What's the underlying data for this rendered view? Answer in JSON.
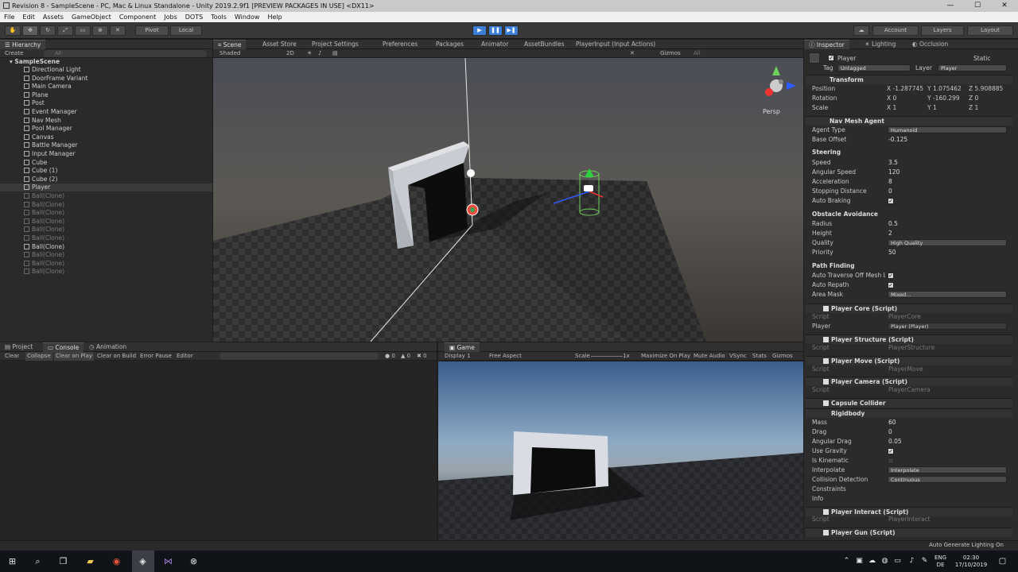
{
  "window": {
    "title": "Revision 8 - SampleScene - PC, Mac & Linux Standalone - Unity 2019.2.9f1 [PREVIEW PACKAGES IN USE] <DX11>",
    "controls": [
      "—",
      "☐",
      "✕"
    ]
  },
  "menu": [
    "File",
    "Edit",
    "Assets",
    "GameObject",
    "Component",
    "Jobs",
    "DOTS",
    "Tools",
    "Window",
    "Help"
  ],
  "toolbar": {
    "pivot": "Pivot",
    "local": "Local",
    "account": "Account",
    "layers": "Layers",
    "layout": "Layout"
  },
  "hierarchy": {
    "tab": "Hierarchy",
    "create": "Create",
    "search_placeholder": "All",
    "scene": "SampleScene",
    "items": [
      {
        "label": "Directional Light",
        "dim": false
      },
      {
        "label": "DoorFrame Variant",
        "dim": false
      },
      {
        "label": "Main Camera",
        "dim": false
      },
      {
        "label": "Plane",
        "dim": false
      },
      {
        "label": "Post",
        "dim": false
      },
      {
        "label": "Event Manager",
        "dim": false
      },
      {
        "label": "Nav Mesh",
        "dim": false
      },
      {
        "label": "Pool Manager",
        "dim": false
      },
      {
        "label": "Canvas",
        "dim": false
      },
      {
        "label": "Battle Manager",
        "dim": false
      },
      {
        "label": "Input Manager",
        "dim": false
      },
      {
        "label": "Cube",
        "dim": false
      },
      {
        "label": "Cube (1)",
        "dim": false
      },
      {
        "label": "Cube (2)",
        "dim": false
      },
      {
        "label": "Player",
        "dim": false
      },
      {
        "label": "Ball(Clone)",
        "dim": true
      },
      {
        "label": "Ball(Clone)",
        "dim": true
      },
      {
        "label": "Ball(Clone)",
        "dim": true
      },
      {
        "label": "Ball(Clone)",
        "dim": true
      },
      {
        "label": "Ball(Clone)",
        "dim": true
      },
      {
        "label": "Ball(Clone)",
        "dim": true
      },
      {
        "label": "Ball(Clone)",
        "dim": false
      },
      {
        "label": "Ball(Clone)",
        "dim": true
      },
      {
        "label": "Ball(Clone)",
        "dim": true
      },
      {
        "label": "Ball(Clone)",
        "dim": true
      }
    ]
  },
  "scene_tabs": [
    "Scene",
    "Asset Store",
    "Project Settings",
    "Preferences",
    "Packages",
    "Animator",
    "AssetBundles",
    "PlayerInput (Input Actions)"
  ],
  "scene_bar": {
    "shading": "Shaded",
    "mode_2d": "2D",
    "gizmos": "Gizmos",
    "search_placeholder": "All",
    "persp": "Persp"
  },
  "bottom_tabs": [
    "Project",
    "Console",
    "Animation"
  ],
  "console_bar": [
    "Clear",
    "Collapse",
    "Clear on Play",
    "Clear on Build",
    "Error Pause",
    "Editor"
  ],
  "console_counts": [
    "0",
    "0",
    "0"
  ],
  "game": {
    "tab": "Game",
    "display": "Display 1",
    "aspect": "Free Aspect",
    "scale_label": "Scale",
    "scale_value": "1x",
    "options": [
      "Maximize On Play",
      "Mute Audio",
      "VSync",
      "Stats",
      "Gizmos"
    ]
  },
  "inspector": {
    "tabs": [
      "Inspector",
      "Lighting",
      "Occlusion"
    ],
    "object_name": "Player",
    "static_label": "Static",
    "tag_label": "Tag",
    "tag_value": "Untagged",
    "layer_label": "Layer",
    "layer_value": "Player",
    "transform": {
      "title": "Transform",
      "position_label": "Position",
      "position": {
        "x": "-1.287745",
        "y": "1.075462",
        "z": "5.908885"
      },
      "rotation_label": "Rotation",
      "rotation": {
        "x": "0",
        "y": "-160.299",
        "z": "0"
      },
      "scale_label": "Scale",
      "scale": {
        "x": "1",
        "y": "1",
        "z": "1"
      }
    },
    "nav_agent": {
      "title": "Nav Mesh Agent",
      "agent_type_label": "Agent Type",
      "agent_type": "Humanoid",
      "base_offset_label": "Base Offset",
      "base_offset": "-0.125",
      "steering": "Steering",
      "speed_label": "Speed",
      "speed": "3.5",
      "angular_speed_label": "Angular Speed",
      "angular_speed": "120",
      "acceleration_label": "Acceleration",
      "acceleration": "8",
      "stopping_label": "Stopping Distance",
      "stopping": "0",
      "auto_braking_label": "Auto Braking",
      "obstacle": "Obstacle Avoidance",
      "radius_label": "Radius",
      "radius": "0.5",
      "height_label": "Height",
      "height": "2",
      "quality_label": "Quality",
      "quality": "High Quality",
      "priority_label": "Priority",
      "priority": "50",
      "path": "Path Finding",
      "auto_traverse_label": "Auto Traverse Off Mesh Link",
      "auto_repath_label": "Auto Repath",
      "area_mask_label": "Area Mask",
      "area_mask": "Mixed..."
    },
    "script_label": "Script",
    "player_core": {
      "title": "Player Core (Script)",
      "script": "PlayerCore",
      "player_label": "Player",
      "player": "Player (Player)"
    },
    "player_structure": {
      "title": "Player Structure (Script)",
      "script": "PlayerStructure"
    },
    "player_move": {
      "title": "Player Move (Script)",
      "script": "PlayerMove"
    },
    "player_camera": {
      "title": "Player Camera (Script)",
      "script": "PlayerCamera"
    },
    "capsule": {
      "title": "Capsule Collider"
    },
    "rigidbody": {
      "title": "Rigidbody",
      "mass_label": "Mass",
      "mass": "60",
      "drag_label": "Drag",
      "drag": "0",
      "angular_drag_label": "Angular Drag",
      "angular_drag": "0.05",
      "gravity_label": "Use Gravity",
      "kinematic_label": "Is Kinematic",
      "interpolate_label": "Interpolate",
      "interpolate": "Interpolate",
      "collision_label": "Collision Detection",
      "collision": "Continuous",
      "constraints_label": "Constraints",
      "info_label": "Info"
    },
    "player_interact": {
      "title": "Player Interact (Script)",
      "script": "PlayerInteract"
    },
    "player_gun": {
      "title": "Player Gun (Script)"
    },
    "status": "Auto Generate Lighting On"
  },
  "taskbar": {
    "lang": "ENG",
    "region": "DE",
    "time": "02:30",
    "date": "17/10/2019"
  }
}
